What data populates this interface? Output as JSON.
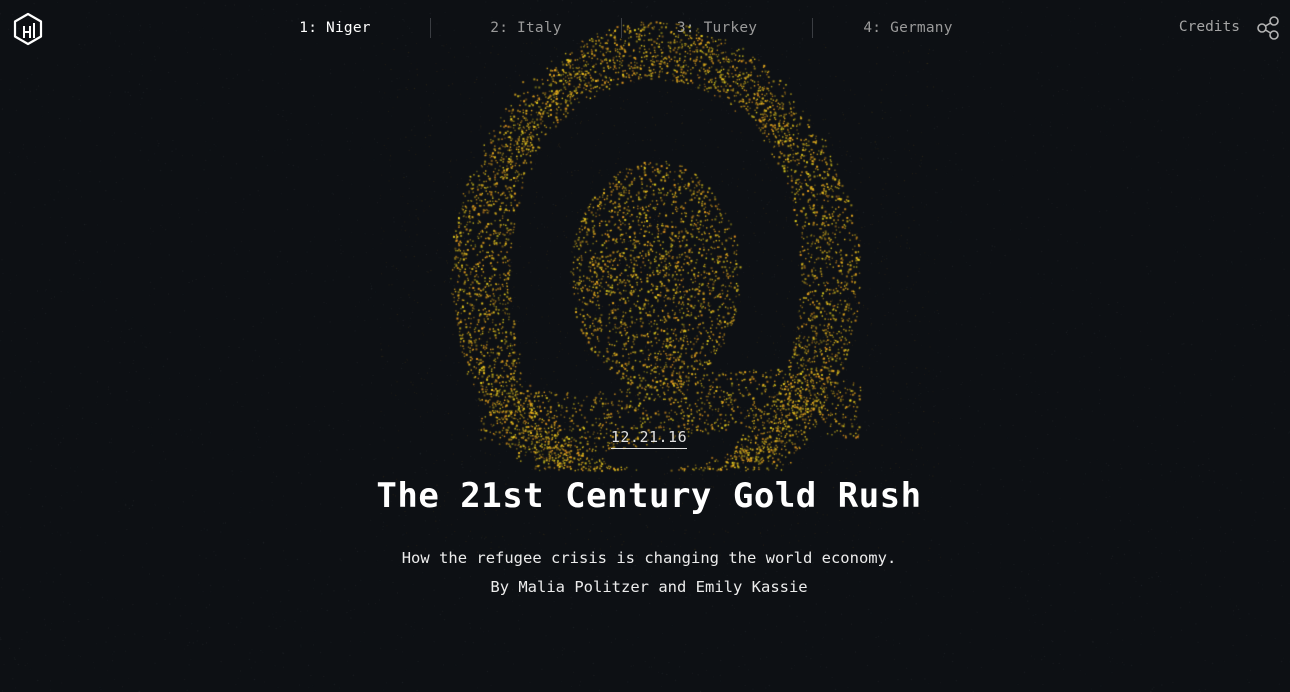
{
  "nav": {
    "items": [
      {
        "label": "1: Niger",
        "active": true
      },
      {
        "label": "2: Italy",
        "active": false
      },
      {
        "label": "3: Turkey",
        "active": false
      },
      {
        "label": "4: Germany",
        "active": false
      }
    ],
    "credits_label": "Credits"
  },
  "hero": {
    "date": "12.21.16",
    "title": "The 21st Century Gold Rush",
    "subtitle": "How the refugee crisis is changing the world economy.",
    "byline": "By Malia Politzer and Emily Kassie"
  },
  "icons": {
    "logo": "hexagon-logo-icon",
    "share": "share-icon"
  },
  "colors": {
    "background": "#0d1014",
    "gold": "#e8b422",
    "text": "#ffffff",
    "nav_inactive": "#9a9a9a"
  }
}
